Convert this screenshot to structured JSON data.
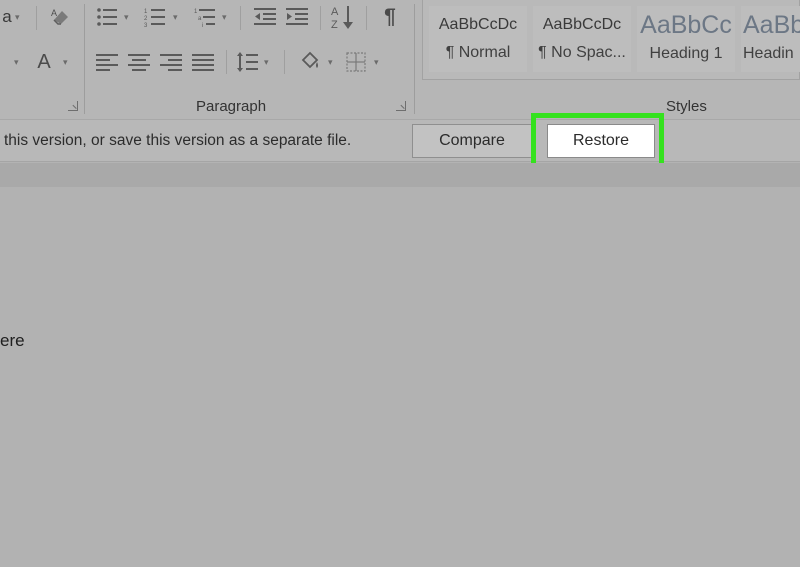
{
  "ribbon": {
    "font_group": {
      "font_name_tail": "a",
      "font_color_letter": "A"
    },
    "paragraph": {
      "label": "Paragraph",
      "pilcrow": "¶"
    },
    "styles": {
      "label": "Styles",
      "items": [
        {
          "sample": "AaBbCcDc",
          "name": "¶ Normal"
        },
        {
          "sample": "AaBbCcDc",
          "name": "¶ No Spac..."
        },
        {
          "sample": "AaBbCc",
          "name": "Heading 1"
        },
        {
          "sample": "AaBb",
          "name": "Headin"
        }
      ]
    }
  },
  "version_bar": {
    "message": "this version, or save this version as a separate file.",
    "compare_label": "Compare",
    "restore_label": "Restore",
    "highlight_color": "#34e21e"
  },
  "document": {
    "text": "ere"
  }
}
